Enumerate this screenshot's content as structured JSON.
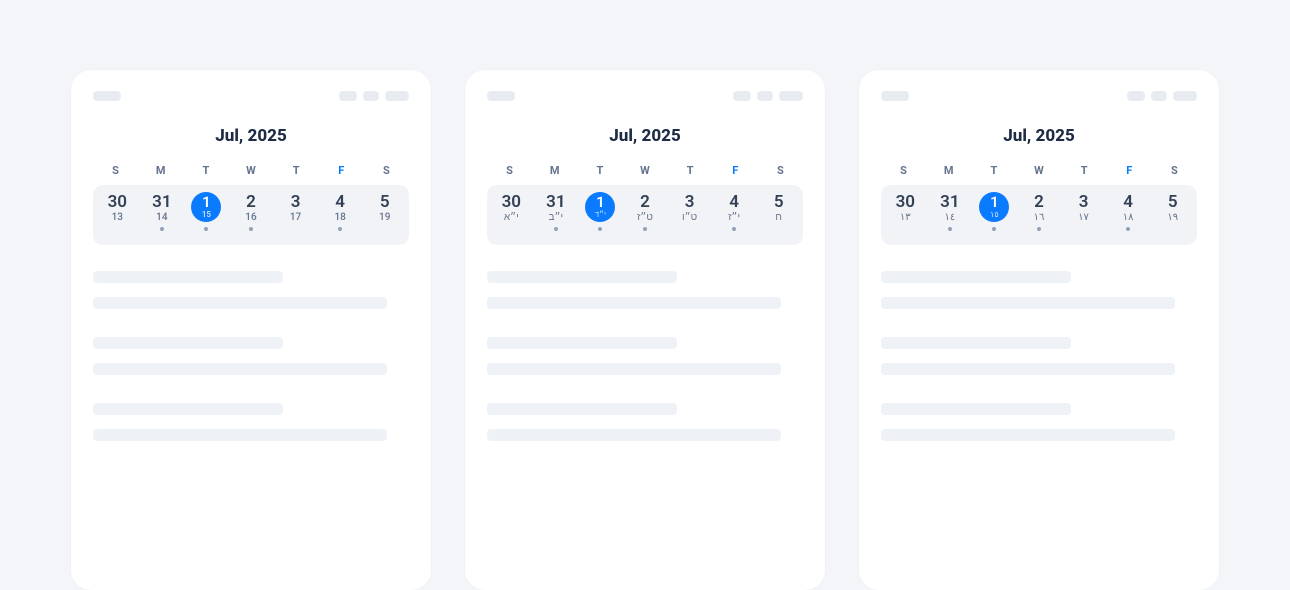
{
  "month_title": "Jul, 2025",
  "weekdays": [
    "S",
    "M",
    "T",
    "W",
    "T",
    "F",
    "S"
  ],
  "weekday_highlight_index": 5,
  "cards": [
    {
      "days": [
        {
          "primary": "30",
          "secondary": "13",
          "dot": false,
          "selected": false
        },
        {
          "primary": "31",
          "secondary": "14",
          "dot": true,
          "selected": false
        },
        {
          "primary": "1",
          "secondary": "15",
          "dot": true,
          "selected": true
        },
        {
          "primary": "2",
          "secondary": "16",
          "dot": true,
          "selected": false
        },
        {
          "primary": "3",
          "secondary": "17",
          "dot": false,
          "selected": false
        },
        {
          "primary": "4",
          "secondary": "18",
          "dot": true,
          "selected": false
        },
        {
          "primary": "5",
          "secondary": "19",
          "dot": false,
          "selected": false
        }
      ]
    },
    {
      "days": [
        {
          "primary": "30",
          "secondary": "י״א",
          "dot": false,
          "selected": false
        },
        {
          "primary": "31",
          "secondary": "י״ב",
          "dot": true,
          "selected": false
        },
        {
          "primary": "1",
          "secondary": "י״ד",
          "dot": true,
          "selected": true
        },
        {
          "primary": "2",
          "secondary": "ט״ז",
          "dot": true,
          "selected": false
        },
        {
          "primary": "3",
          "secondary": "ט״ו",
          "dot": false,
          "selected": false
        },
        {
          "primary": "4",
          "secondary": "י״ז",
          "dot": true,
          "selected": false
        },
        {
          "primary": "5",
          "secondary": "ח",
          "dot": false,
          "selected": false
        }
      ]
    },
    {
      "days": [
        {
          "primary": "30",
          "secondary": "١٣",
          "dot": false,
          "selected": false
        },
        {
          "primary": "31",
          "secondary": "١٤",
          "dot": true,
          "selected": false
        },
        {
          "primary": "1",
          "secondary": "١٥",
          "dot": true,
          "selected": true
        },
        {
          "primary": "2",
          "secondary": "١٦",
          "dot": true,
          "selected": false
        },
        {
          "primary": "3",
          "secondary": "١٧",
          "dot": false,
          "selected": false
        },
        {
          "primary": "4",
          "secondary": "١٨",
          "dot": true,
          "selected": false
        },
        {
          "primary": "5",
          "secondary": "١٩",
          "dot": false,
          "selected": false
        }
      ]
    }
  ]
}
